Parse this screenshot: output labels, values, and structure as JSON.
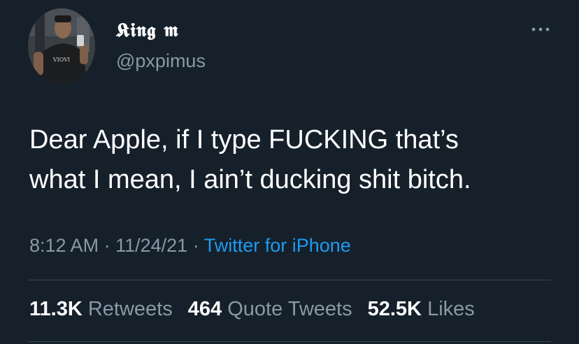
{
  "author": {
    "display_name": "𝕶𝖎𝖓𝖌 𝖒",
    "handle": "@pxpimus",
    "avatar_icon": "profile-photo"
  },
  "tweet": {
    "text_line1": "Dear Apple, if I type FUCKING that’s",
    "text_line2": "what I mean, I ain’t ducking shit bitch.",
    "time": "8:12 AM",
    "date": "11/24/21",
    "separator": "·",
    "source": "Twitter for iPhone"
  },
  "stats": {
    "retweets_count": "11.3K",
    "retweets_label": "Retweets",
    "quotes_count": "464",
    "quotes_label": "Quote Tweets",
    "likes_count": "52.5K",
    "likes_label": "Likes"
  },
  "colors": {
    "background": "#15202b",
    "secondary_text": "#8b98a5",
    "link": "#1d9bf0",
    "divider": "#38444d"
  }
}
